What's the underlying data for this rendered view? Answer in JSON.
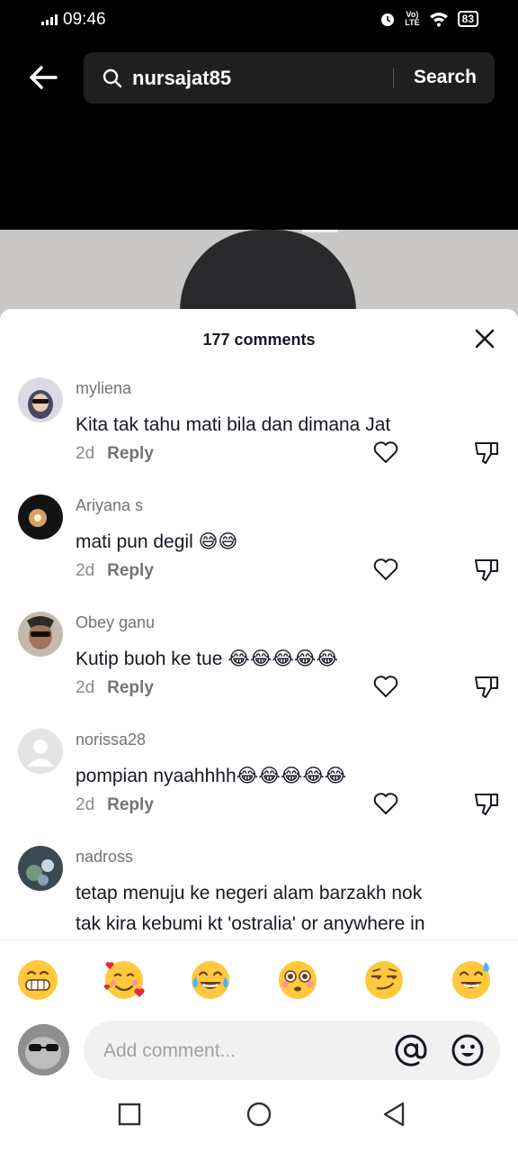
{
  "status": {
    "time": "09:46",
    "volte_top": "Vo)",
    "volte_bottom": "LTE",
    "battery": "83"
  },
  "search": {
    "query": "nursajat85",
    "button_label": "Search"
  },
  "comments_header": {
    "count_label": "177 comments"
  },
  "comments": [
    {
      "user": "myliena",
      "text": "Kita tak tahu mati bila dan dimana Jat",
      "emojis": "",
      "age": "2d",
      "reply_label": "Reply"
    },
    {
      "user": "Ariyana s",
      "text": "mati pun degil ",
      "emojis": "😅😅",
      "age": "2d",
      "reply_label": "Reply"
    },
    {
      "user": "Obey ganu",
      "text": "Kutip buoh ke tue ",
      "emojis": "😂😂😂😂😂",
      "age": "2d",
      "reply_label": "Reply"
    },
    {
      "user": "norissa28",
      "text": "pompian nyaahhhh",
      "emojis": "😂😂😂😂😂",
      "age": "2d",
      "reply_label": "Reply"
    },
    {
      "user": "nadross",
      "text": "tetap menuju ke negeri alam barzakh nok",
      "text2": "tak kira kebumi kt 'ostralia' or anywhere in"
    }
  ],
  "quick_emojis": [
    "😁",
    "🥰",
    "😂",
    "😳",
    "😏",
    "😅"
  ],
  "composer": {
    "placeholder": "Add comment..."
  },
  "colors": {
    "accent_text": "#161823",
    "muted_text": "#727378",
    "background": "#ffffff",
    "top_bar": "#000000"
  }
}
